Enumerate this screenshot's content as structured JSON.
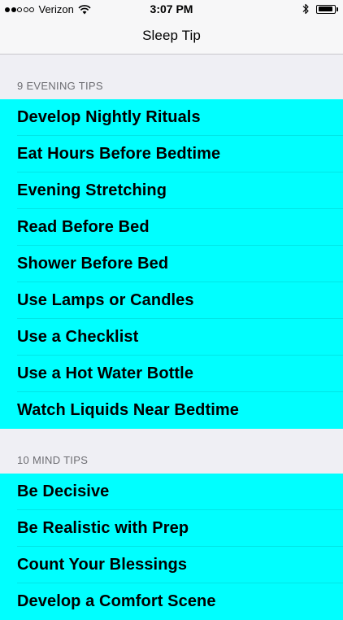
{
  "status": {
    "carrier": "Verizon",
    "time": "3:07 PM",
    "signal_filled": 2,
    "signal_total": 5,
    "battery_level": 0.9
  },
  "nav": {
    "title": "Sleep Tip"
  },
  "sections": [
    {
      "header": "9 EVENING TIPS",
      "items": [
        "Develop Nightly Rituals",
        "Eat Hours Before Bedtime",
        "Evening Stretching",
        "Read Before Bed",
        "Shower Before Bed",
        "Use Lamps or Candles",
        "Use a Checklist",
        "Use a Hot Water Bottle",
        "Watch Liquids Near Bedtime"
      ]
    },
    {
      "header": "10 MIND TIPS",
      "items": [
        "Be Decisive",
        "Be Realistic with Prep",
        "Count Your Blessings",
        "Develop a Comfort Scene"
      ]
    }
  ],
  "colors": {
    "list_background": "#00ffff",
    "page_background": "#efeff4",
    "header_text": "#6d6d72"
  },
  "icons": [
    "signal-dots-icon",
    "wifi-icon",
    "bluetooth-icon",
    "battery-icon"
  ]
}
